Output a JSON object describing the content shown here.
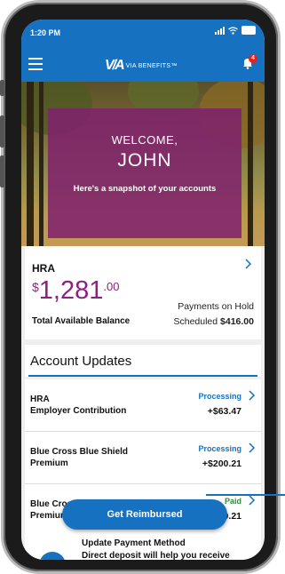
{
  "status_bar": {
    "time": "1:20 PM"
  },
  "nav": {
    "logo_mark": "V/A",
    "logo_text": "VIA BENEFITS™",
    "notification_count": "4"
  },
  "hero": {
    "welcome": "WELCOME,",
    "name": "JOHN",
    "subtitle": "Here's a snapshot of your accounts"
  },
  "hra_card": {
    "title": "HRA",
    "currency": "$",
    "amount_whole": "1,281",
    "amount_cents": ".00",
    "balance_label": "Total Available Balance",
    "hold_label": "Payments on Hold",
    "scheduled_label": "Scheduled",
    "scheduled_amount": "$416.00"
  },
  "account_updates": {
    "title": "Account Updates",
    "rows": [
      {
        "line1": "HRA",
        "line2": "Employer Contribution",
        "status": "Processing",
        "amount": "+$63.47",
        "status_color": "#1671c1"
      },
      {
        "line1": "Blue Cross Blue Shield",
        "line2": "Premium",
        "status": "Processing",
        "amount": "+$200.21",
        "status_color": "#1671c1"
      },
      {
        "line1": "Blue Cross Blue Shield",
        "line2": "Premium",
        "status": "Paid",
        "amount": "+$200.21",
        "status_color": "#2e8b3a"
      }
    ]
  },
  "bottom_card": {
    "title": "Update Payment Method",
    "text": "Direct deposit will help you receive"
  },
  "reimburse_button": {
    "label": "Get Reimbursed"
  },
  "colors": {
    "brand_blue": "#1671c1",
    "plum": "#8a2380",
    "badge_red": "#e2231a"
  }
}
